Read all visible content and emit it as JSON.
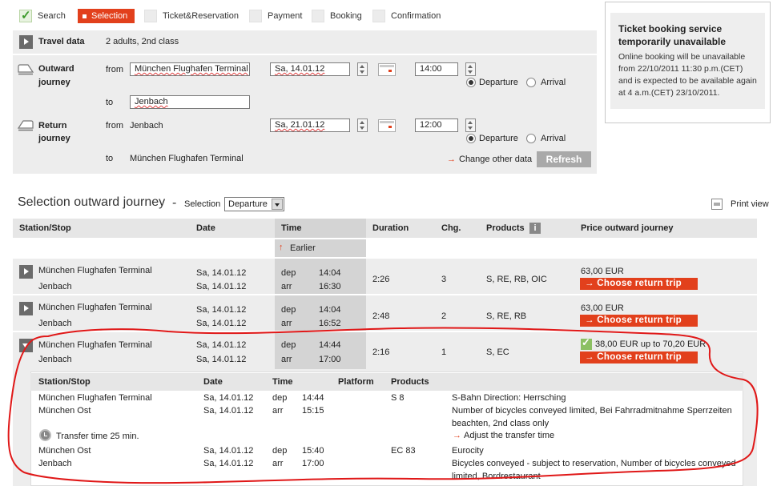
{
  "steps": [
    {
      "label": "Search",
      "state": "done"
    },
    {
      "label": "Selection",
      "state": "active"
    },
    {
      "label": "Ticket&Reservation",
      "state": "pending"
    },
    {
      "label": "Payment",
      "state": "pending"
    },
    {
      "label": "Booking",
      "state": "pending"
    },
    {
      "label": "Confirmation",
      "state": "pending"
    }
  ],
  "travel": {
    "title": "Travel data",
    "summary": "2 adults, 2nd class",
    "outward_label_1": "Outward",
    "outward_label_2": "journey",
    "return_label_1": "Return",
    "return_label_2": "journey",
    "from_label": "from",
    "to_label": "to",
    "outward_from": "München Flughafen Terminal",
    "outward_to": "Jenbach",
    "outward_date": "Sa, 14.01.12",
    "outward_time": "14:00",
    "return_from": "Jenbach",
    "return_to": "München Flughafen Terminal",
    "return_date": "Sa, 21.01.12",
    "return_time": "12:00",
    "departure_label": "Departure",
    "arrival_label": "Arrival",
    "change_other": "Change other data",
    "refresh": "Refresh"
  },
  "notice": {
    "title": "Ticket booking service temporarily unavailable",
    "text": "Online booking will be unavailable from 22/10/2011 11:30 p.m.(CET) and is expected to be available again at 4 a.m.(CET) 23/10/2011."
  },
  "results": {
    "title": "Selection outward journey",
    "dash": "-",
    "selection_label": "Selection",
    "selection_value": "Departure",
    "print_view": "Print view",
    "headers": {
      "station": "Station/Stop",
      "date": "Date",
      "time": "Time",
      "duration": "Duration",
      "chg": "Chg.",
      "products": "Products",
      "price": "Price outward journey"
    },
    "earlier": "Earlier",
    "dep": "dep",
    "arr": "arr",
    "choose_return": "Choose return trip",
    "rows": [
      {
        "from": "München Flughafen Terminal",
        "to": "Jenbach",
        "date_dep": "Sa, 14.01.12",
        "date_arr": "Sa, 14.01.12",
        "dep": "14:04",
        "arr": "16:30",
        "duration": "2:26",
        "chg": "3",
        "products": "S, RE, RB, OIC",
        "price": "63,00 EUR"
      },
      {
        "from": "München Flughafen Terminal",
        "to": "Jenbach",
        "date_dep": "Sa, 14.01.12",
        "date_arr": "Sa, 14.01.12",
        "dep": "14:04",
        "arr": "16:52",
        "duration": "2:48",
        "chg": "2",
        "products": "S, RE, RB",
        "price": "63,00 EUR"
      },
      {
        "from": "München Flughafen Terminal",
        "to": "Jenbach",
        "date_dep": "Sa, 14.01.12",
        "date_arr": "Sa, 14.01.12",
        "dep": "14:44",
        "arr": "17:00",
        "duration": "2:16",
        "chg": "1",
        "products": "S, EC",
        "price": "38,00 EUR up to 70,20 EUR"
      }
    ]
  },
  "detail": {
    "headers": {
      "station": "Station/Stop",
      "date": "Date",
      "time": "Time",
      "platform": "Platform",
      "products": "Products"
    },
    "legs": [
      {
        "station": "München Flughafen Terminal",
        "date": "Sa, 14.01.12",
        "kind": "dep",
        "time": "14:44",
        "product": "S 8",
        "info": "S-Bahn Direction: Herrsching"
      },
      {
        "station": "München Ost",
        "date": "Sa, 14.01.12",
        "kind": "arr",
        "time": "15:15",
        "product": "",
        "info_1": "Number of bicycles conveyed limited, Bei Fahrradmitnahme Sperrzeiten",
        "info_2": "beachten, 2nd class only"
      },
      {
        "station": "München Ost",
        "date": "Sa, 14.01.12",
        "kind": "dep",
        "time": "15:40",
        "product": "EC 83",
        "info": "Eurocity"
      },
      {
        "station": "Jenbach",
        "date": "Sa, 14.01.12",
        "kind": "arr",
        "time": "17:00",
        "product": "",
        "info_1": "Bicycles conveyed - subject to reservation, Number of bicycles conveyed",
        "info_2": "limited, Bordrestaurant"
      }
    ],
    "transfer": "Transfer time 25 min.",
    "adjust_transfer": "Adjust the transfer time"
  },
  "colors": {
    "accent": "#e2401c",
    "panel": "#ededed",
    "header": "#e6e6e6",
    "annotation": "#e01818"
  }
}
